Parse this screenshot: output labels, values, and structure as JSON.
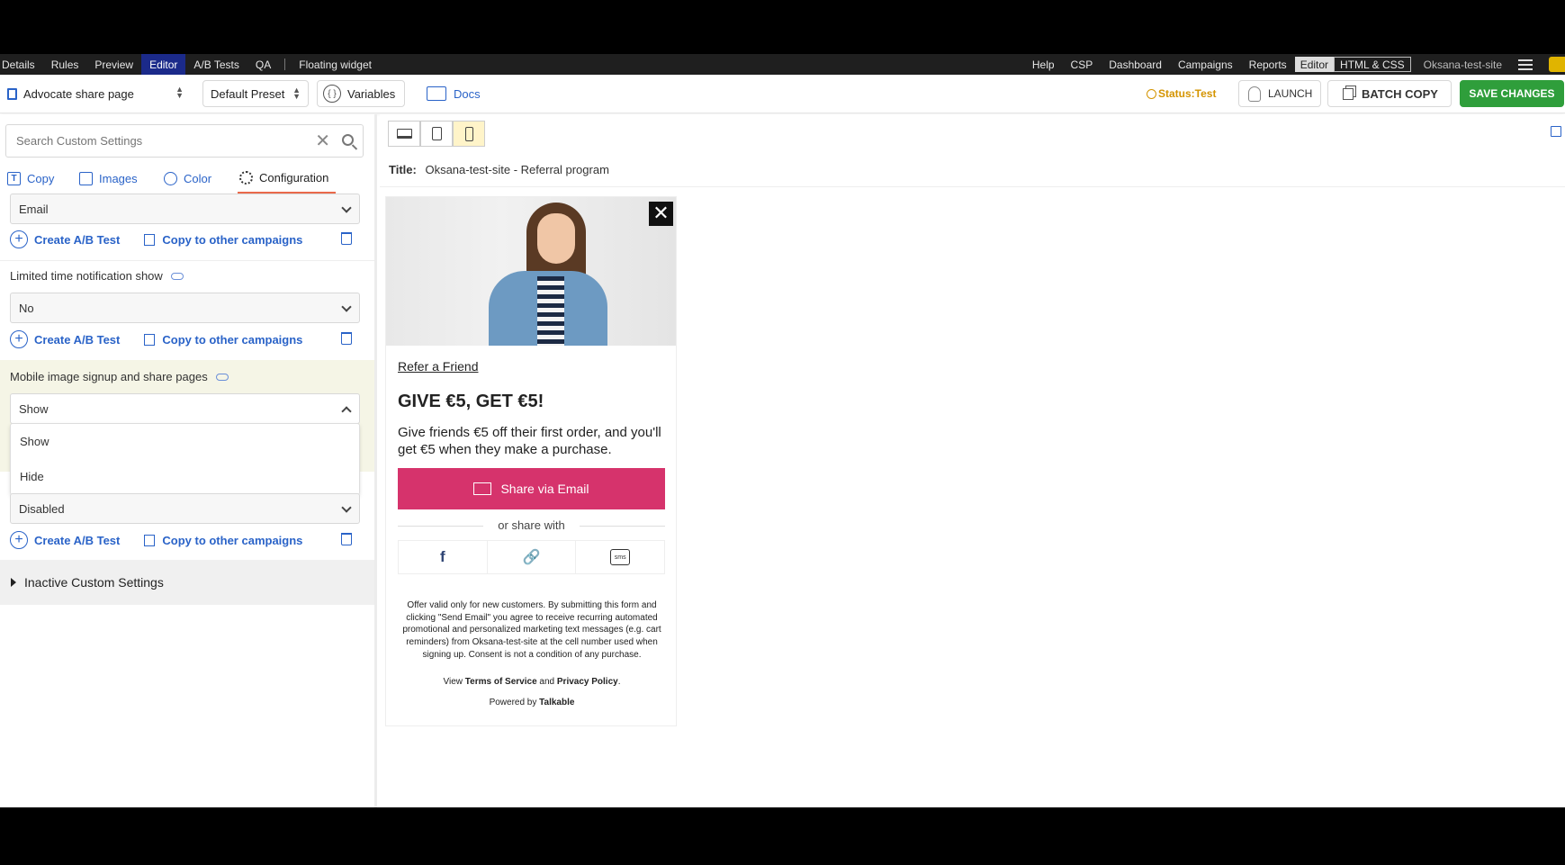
{
  "topnav": {
    "left": [
      "Details",
      "Rules",
      "Preview",
      "Editor",
      "A/B Tests",
      "QA"
    ],
    "active": "Editor",
    "widget": "Floating widget",
    "right": [
      "Help",
      "CSP",
      "Dashboard",
      "Campaigns",
      "Reports"
    ],
    "editor_toggle": "Editor",
    "html_css": "HTML & CSS",
    "site": "Oksana-test-site"
  },
  "toolbar": {
    "page": "Advocate share page",
    "preset": "Default Preset",
    "variables": "Variables",
    "docs": "Docs",
    "status": "Status:Test",
    "launch": "LAUNCH",
    "batch_copy": "BATCH COPY",
    "save": "SAVE CHANGES",
    "save_color": "#2f9e3b",
    "status_color": "#d49400"
  },
  "left": {
    "search_placeholder": "Search Custom Settings",
    "tabs": [
      "Copy",
      "Images",
      "Color",
      "Configuration"
    ],
    "active_tab": "Configuration",
    "setting1_value": "Email",
    "create_ab": "Create A/B Test",
    "copy_other": "Copy to other campaigns",
    "setting2_label": "Limited time notification show",
    "setting2_value": "No",
    "setting3_label": "Mobile image signup and share pages",
    "setting3_value": "Show",
    "dropdown_options": [
      "Show",
      "Hide"
    ],
    "setting4_value": "Disabled",
    "inactive": "Inactive Custom Settings"
  },
  "preview": {
    "title_label": "Title:",
    "title_value": "Oksana-test-site - Referral program",
    "refer": "Refer a Friend",
    "headline": "GIVE €5, GET €5!",
    "description": "Give friends €5 off their first order, and you'll get €5 when they make a purchase.",
    "share_button": "Share via Email",
    "share_color": "#d6336c",
    "or_share": "or share with",
    "legal": "Offer valid only for new customers. By submitting this form and clicking \"Send Email\" you agree to receive recurring automated promotional and personalized marketing text messages (e.g. cart reminders) from Oksana-test-site at the cell number used when signing up. Consent is not a condition of any purchase.",
    "terms_prefix": "View",
    "terms": "Terms of Service",
    "and": "and",
    "privacy": "Privacy Policy",
    "period": ".",
    "powered_prefix": "Powered by",
    "powered_brand": "Talkable",
    "sms": "sms",
    "facebook": "f"
  }
}
